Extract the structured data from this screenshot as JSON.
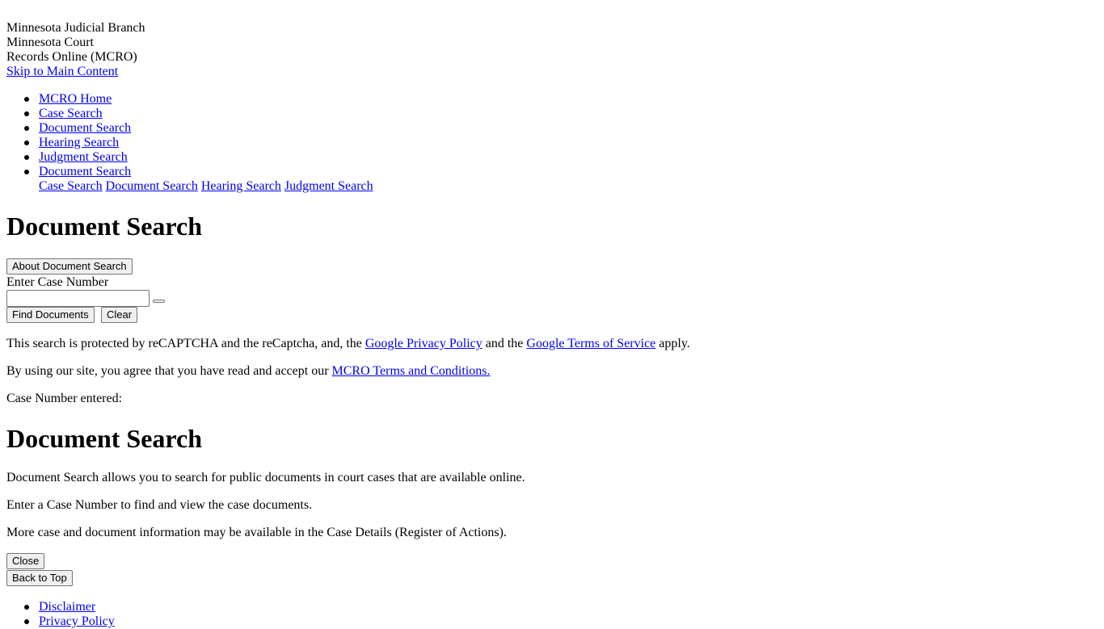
{
  "header": {
    "line1": "Minnesota Judicial Branch",
    "line2": "Minnesota Court",
    "line3": "Records Online (MCRO)",
    "skip_link": "Skip to Main Content"
  },
  "nav": {
    "items": [
      {
        "label": "MCRO Home"
      },
      {
        "label": "Case Search"
      },
      {
        "label": "Document Search"
      },
      {
        "label": "Hearing Search"
      },
      {
        "label": "Judgment Search"
      },
      {
        "label": "Document Search"
      }
    ],
    "sub_items": [
      {
        "label": "Case Search"
      },
      {
        "label": "Document Search"
      },
      {
        "label": "Hearing Search"
      },
      {
        "label": "Judgment Search"
      }
    ]
  },
  "main": {
    "title": "Document Search",
    "about_button": "About Document Search",
    "case_number_label": "Enter Case Number",
    "case_number_value": "",
    "find_button": "Find Documents",
    "clear_button": "Clear",
    "recaptcha": {
      "before": "This search is protected by reCAPTCHA and the reCaptcha, and, the",
      "privacy_link": "Google Privacy Policy",
      "middle": "and the",
      "terms_link": "Google Terms of Service",
      "after": "apply."
    },
    "agreement": {
      "before": "By using our site, you agree that you have read and accept our",
      "link": "MCRO Terms and Conditions."
    },
    "case_number_entered": "Case Number entered:"
  },
  "about": {
    "title": "Document Search",
    "p1": "Document Search allows you to search for public documents in court cases that are available online.",
    "p2": "Enter a Case Number to find and view the case documents.",
    "p3": "More case and document information may be available in the Case Details (Register of Actions).",
    "close_button": "Close"
  },
  "back_to_top": "Back to Top",
  "footer": {
    "items": [
      {
        "label": "Disclaimer"
      },
      {
        "label": "Privacy Policy"
      }
    ]
  },
  "colors": {
    "link": "#0000ee",
    "text": "#000000",
    "background": "#ffffff",
    "button_bg": "#efefef",
    "button_border": "#767676"
  }
}
